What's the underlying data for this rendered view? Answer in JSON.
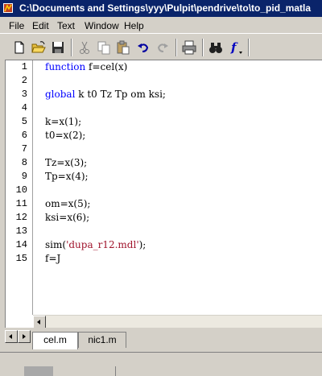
{
  "window": {
    "title": "C:\\Documents and Settings\\yyy\\Pulpit\\pendrive\\to\\to_pid_matla"
  },
  "menu": [
    "File",
    "Edit",
    "Text",
    "Window",
    "Help"
  ],
  "toolbar": {
    "buttons": [
      "new-document",
      "open-folder",
      "save",
      "cut",
      "copy",
      "paste",
      "undo",
      "redo",
      "print",
      "find",
      "function"
    ]
  },
  "editor": {
    "lines": [
      {
        "num": "1",
        "text": "function f=cel(x)"
      },
      {
        "num": "2",
        "text": ""
      },
      {
        "num": "3",
        "text": "global k t0 Tz Tp om ksi;"
      },
      {
        "num": "4",
        "text": ""
      },
      {
        "num": "5",
        "text": "k=x(1);"
      },
      {
        "num": "6",
        "text": "t0=x(2);"
      },
      {
        "num": "7",
        "text": ""
      },
      {
        "num": "8",
        "text": "Tz=x(3);"
      },
      {
        "num": "9",
        "text": "Tp=x(4);"
      },
      {
        "num": "10",
        "text": ""
      },
      {
        "num": "11",
        "text": "om=x(5);"
      },
      {
        "num": "12",
        "text": "ksi=x(6);"
      },
      {
        "num": "13",
        "text": ""
      },
      {
        "num": "14",
        "text": "sim('dupa_r12.mdl');"
      },
      {
        "num": "15",
        "text": "f=J"
      }
    ],
    "keyword_function": "function",
    "line1_rest": " f=cel(x)",
    "keyword_global": "global",
    "line3_rest": " k t0 Tz Tp om ksi;",
    "line14_prefix": "sim(",
    "line14_string": "'dupa_r12.mdl'",
    "line14_suffix": ");"
  },
  "tabs": [
    {
      "label": "cel.m",
      "active": true
    },
    {
      "label": "nic1.m",
      "active": false
    }
  ],
  "colors": {
    "keyword": "#0000ff",
    "string": "#a0142c",
    "titlebar": "#0a246a"
  }
}
